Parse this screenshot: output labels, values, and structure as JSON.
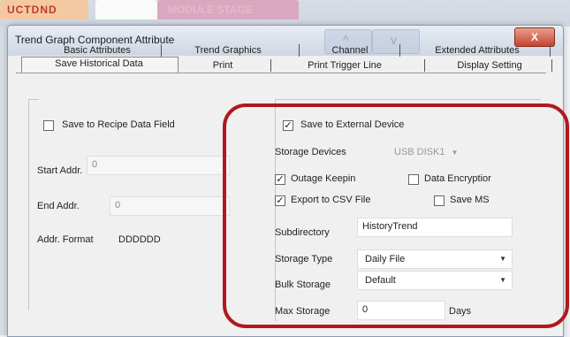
{
  "background": {
    "tab1_label": "UCTDND",
    "tab3_label": "MODULE STAGE"
  },
  "dialog": {
    "title": "Trend Graph Component Attribute",
    "close_label": "X"
  },
  "tabs": {
    "row1": [
      "Basic Attributes",
      "Trend Graphics",
      "Channel",
      "Extended Attributes"
    ],
    "row2": [
      "Save Historical Data",
      "Print",
      "Print Trigger Line",
      "Display Setting"
    ],
    "active": "Save Historical Data"
  },
  "left": {
    "save_recipe_label": "Save to Recipe Data Field",
    "save_recipe_checked": false,
    "start_addr_label": "Start Addr.",
    "start_addr_value": "0",
    "end_addr_label": "End Addr.",
    "end_addr_value": "0",
    "addr_format_label": "Addr. Format",
    "addr_format_value": "DDDDDD"
  },
  "right": {
    "save_external_label": "Save to External Device",
    "save_external_checked": true,
    "storage_devices_label": "Storage Devices",
    "storage_devices_value": "USB DISK1",
    "outage_keepin_label": "Outage Keepin",
    "outage_keepin_checked": true,
    "data_encryption_label": "Data Encryptior",
    "data_encryption_checked": false,
    "export_csv_label": "Export to CSV File",
    "export_csv_checked": true,
    "save_ms_label": "Save MS",
    "save_ms_checked": false,
    "subdirectory_label": "Subdirectory",
    "subdirectory_value": "HistoryTrend",
    "storage_type_label": "Storage Type",
    "storage_type_value": "Daily File",
    "bulk_storage_label": "Bulk Storage",
    "bulk_storage_value": "Default",
    "max_storage_label": "Max Storage",
    "max_storage_value": "0",
    "max_storage_unit": "Days"
  },
  "colors": {
    "highlight": "#b0181e",
    "close_button": "#c8442f"
  }
}
